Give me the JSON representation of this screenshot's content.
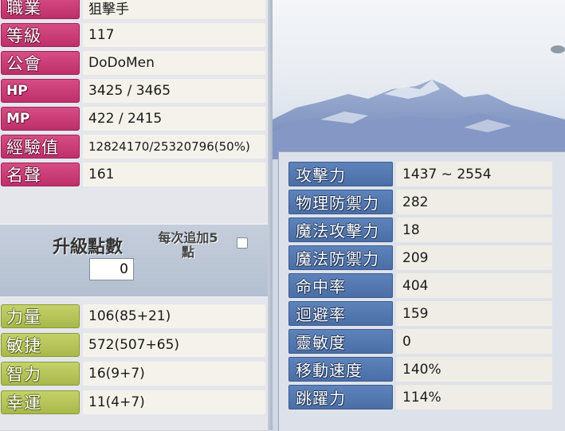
{
  "profile": {
    "items": [
      {
        "label": "職業",
        "value": "狙擊手"
      },
      {
        "label": "等級",
        "value": "117"
      },
      {
        "label": "公會",
        "value": "DoDoMen"
      },
      {
        "label": "HP",
        "value": "3425 / 3465"
      },
      {
        "label": "MP",
        "value": "422 / 2415"
      },
      {
        "label": "經驗值",
        "value": "12824170/25320796(50%)"
      },
      {
        "label": "名聲",
        "value": "161"
      }
    ]
  },
  "ability_points": {
    "title": "升級點數",
    "value": "0",
    "option_label_line1": "每次追加5",
    "option_label_line2": "點"
  },
  "base_stats": {
    "items": [
      {
        "label": "力量",
        "value": "106(85+21)"
      },
      {
        "label": "敏捷",
        "value": "572(507+65)"
      },
      {
        "label": "智力",
        "value": "16(9+7)"
      },
      {
        "label": "幸運",
        "value": "11(4+7)"
      }
    ]
  },
  "detail_stats": {
    "items": [
      {
        "label": "攻擊力",
        "value": "1437 ~ 2554"
      },
      {
        "label": "物理防禦力",
        "value": "282"
      },
      {
        "label": "魔法攻擊力",
        "value": "18"
      },
      {
        "label": "魔法防禦力",
        "value": "209"
      },
      {
        "label": "命中率",
        "value": "404"
      },
      {
        "label": "迴避率",
        "value": "159"
      },
      {
        "label": "靈敏度",
        "value": "0"
      },
      {
        "label": "移動速度",
        "value": "140%"
      },
      {
        "label": "跳躍力",
        "value": "114%"
      }
    ]
  },
  "colors": {
    "label_pink": "#c83a75",
    "label_green": "#b5c458",
    "label_blue": "#567ab3",
    "value_bg": "#f4f2ea"
  }
}
